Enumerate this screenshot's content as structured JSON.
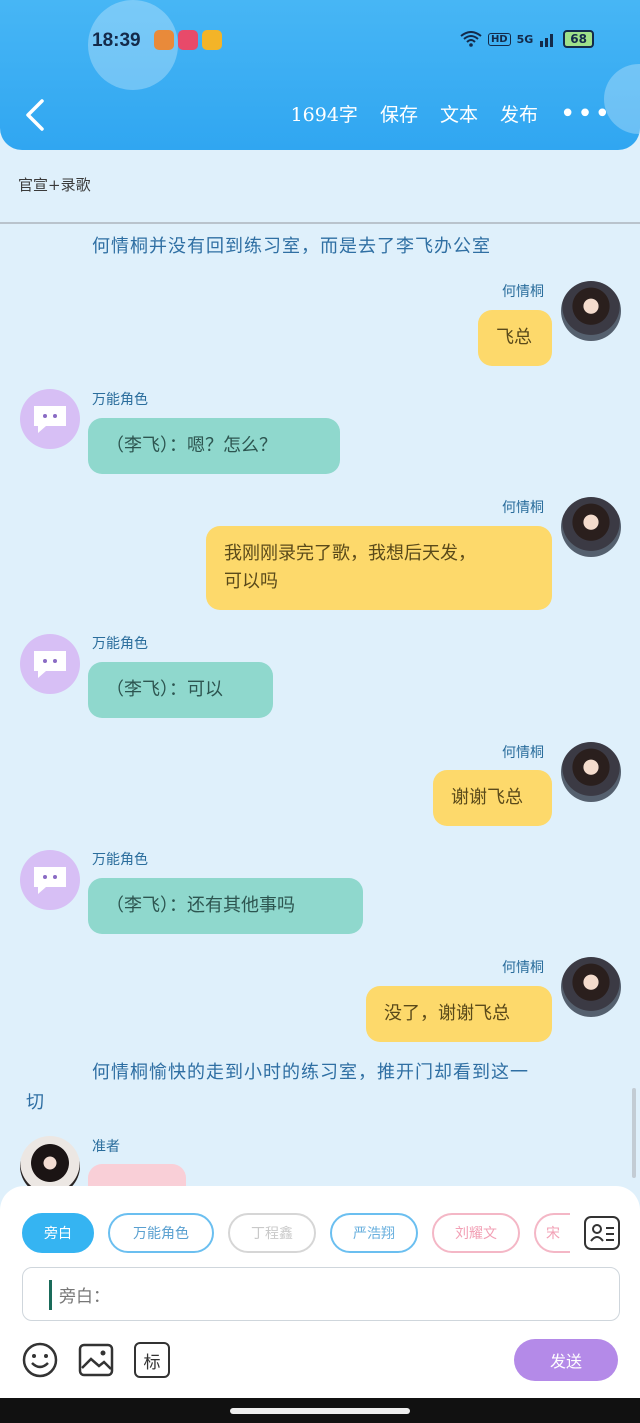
{
  "status_bar": {
    "time": "18:39",
    "battery": "68",
    "network": "5G",
    "hd": "HD"
  },
  "header": {
    "word_count": "1694字",
    "actions": [
      "保存",
      "文本",
      "发布"
    ],
    "more": "•••"
  },
  "tagline": "官宣+录歌",
  "messages": [
    {
      "type": "narration",
      "text": "何情桐并没有回到练习室，而是去了李飞办公室"
    },
    {
      "type": "me",
      "name": "何情桐",
      "text": "飞总"
    },
    {
      "type": "them",
      "name": "万能角色",
      "text": "（李飞）：嗯？怎么？"
    },
    {
      "type": "me",
      "name": "何情桐",
      "text_line1": "我刚刚录完了歌，我想后天发，",
      "text_line2": "可以吗"
    },
    {
      "type": "them",
      "name": "万能角色",
      "text": "（李飞）：可以"
    },
    {
      "type": "me",
      "name": "何情桐",
      "text": "谢谢飞总"
    },
    {
      "type": "them",
      "name": "万能角色",
      "text": "（李飞）：还有其他事吗"
    },
    {
      "type": "me",
      "name": "何情桐",
      "text": "没了，谢谢飞总"
    },
    {
      "type": "narration",
      "text_line1": "何情桐愉快的走到小时的练习室，推开门却看到这一",
      "text_line2": "切"
    },
    {
      "type": "them",
      "name": "准者",
      "text": ""
    }
  ],
  "composer": {
    "chips": [
      "旁白",
      "万能角色",
      "丁程鑫",
      "严浩翔",
      "刘耀文",
      "宋"
    ],
    "placeholder": "旁白：",
    "send_label": "发送",
    "tag_label": "标"
  },
  "colors": {
    "header": "#30a6f1",
    "me_bubble": "#fdd96b",
    "them_bubble": "#8fd8cd",
    "send": "#b48ae8"
  }
}
